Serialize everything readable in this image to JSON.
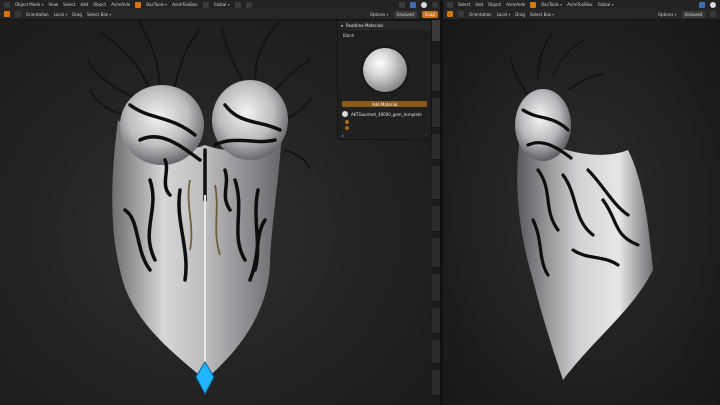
{
  "left_header": {
    "mode": "Object Mode",
    "menu": [
      "View",
      "Select",
      "Add",
      "Object",
      "AnimAide"
    ],
    "addon": "BanTools",
    "anim_toolbox": "AnimToolBox",
    "transform_orientation": "Global",
    "orientation_label": "Orientation",
    "orientation_value": "Local",
    "drag_label": "Drag",
    "drag_value": "Select Box",
    "options": "Options",
    "unsaved": "Unsaved",
    "snap": "Snap"
  },
  "right_header": {
    "menu": [
      "Select",
      "Add",
      "Object",
      "AnimAide"
    ],
    "addon": "BanTools",
    "anim_toolbox": "AnimToolBox",
    "transform_orientation": "Global",
    "orientation_label": "Orientation",
    "orientation_value": "Local",
    "drag_label": "Drag",
    "drag_value": "Select Box",
    "options": "Options",
    "unsaved": "Unsaved"
  },
  "realtime_materials": {
    "title": "Realtime Materials",
    "preset": "Blank",
    "add_button": "Add Material",
    "material_name": "AKTGourmet_40000_gem_template",
    "colors": {
      "accent": "#c8711c",
      "gem": "#1fb6ff"
    }
  },
  "icons": [
    "cursor-icon",
    "move-icon",
    "sphere-shading-icon",
    "gizmo-icon",
    "material-icon"
  ]
}
